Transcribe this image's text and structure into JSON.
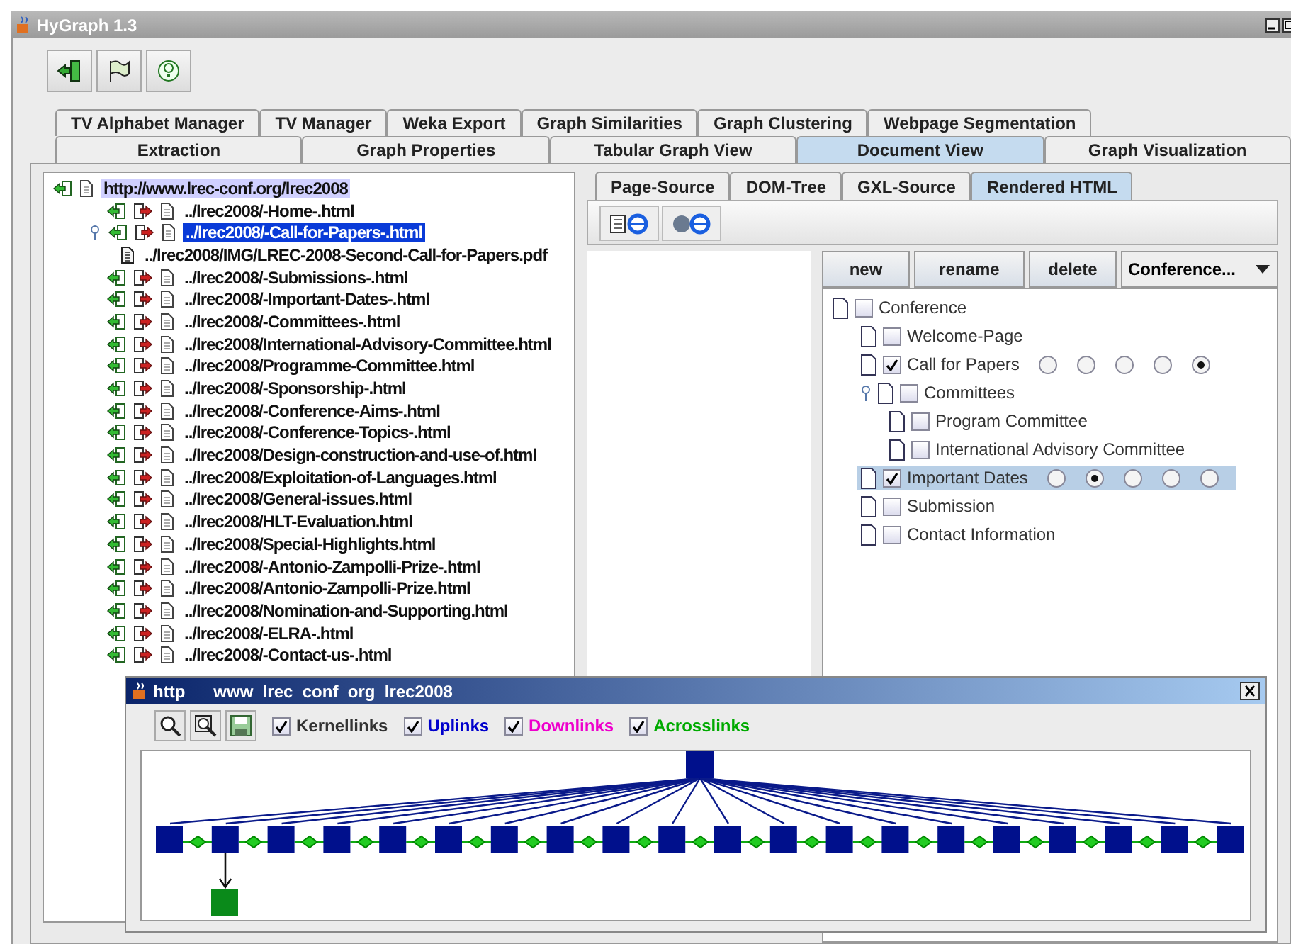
{
  "window": {
    "title": "HyGraph 1.3"
  },
  "tabs_row_1": [
    {
      "label": "TV Alphabet Manager",
      "selected": false
    },
    {
      "label": "TV Manager",
      "selected": false
    },
    {
      "label": "Weka Export",
      "selected": false
    },
    {
      "label": "Graph Similarities",
      "selected": false
    },
    {
      "label": "Graph Clustering",
      "selected": false
    },
    {
      "label": "Webpage Segmentation",
      "selected": false
    }
  ],
  "tabs_row_2": [
    {
      "label": "Extraction",
      "selected": false
    },
    {
      "label": "Graph Properties",
      "selected": false
    },
    {
      "label": "Tabular Graph View",
      "selected": false
    },
    {
      "label": "Document View",
      "selected": true
    },
    {
      "label": "Graph Visualization",
      "selected": false
    }
  ],
  "site_tree": {
    "label": "http://www.lrec-conf.org/lrec2008",
    "kind": "root",
    "highlighted": true,
    "children": [
      {
        "label": "../lrec2008/-Home-.html",
        "kind": "page",
        "selected": false
      },
      {
        "label": "../lrec2008/-Call-for-Papers-.html",
        "kind": "page",
        "selected": true,
        "expanded": true,
        "children": [
          {
            "label": "../lrec2008/IMG/LREC-2008-Second-Call-for-Papers.pdf",
            "kind": "document",
            "selected": false
          }
        ]
      },
      {
        "label": "../lrec2008/-Submissions-.html",
        "kind": "page",
        "selected": false
      },
      {
        "label": "../lrec2008/-Important-Dates-.html",
        "kind": "page",
        "selected": false
      },
      {
        "label": "../lrec2008/-Committees-.html",
        "kind": "page",
        "selected": false
      },
      {
        "label": "../lrec2008/International-Advisory-Committee.html",
        "kind": "page",
        "selected": false
      },
      {
        "label": "../lrec2008/Programme-Committee.html",
        "kind": "page",
        "selected": false
      },
      {
        "label": "../lrec2008/-Sponsorship-.html",
        "kind": "page",
        "selected": false
      },
      {
        "label": "../lrec2008/-Conference-Aims-.html",
        "kind": "page",
        "selected": false
      },
      {
        "label": "../lrec2008/-Conference-Topics-.html",
        "kind": "page",
        "selected": false
      },
      {
        "label": "../lrec2008/Design-construction-and-use-of.html",
        "kind": "page",
        "selected": false
      },
      {
        "label": "../lrec2008/Exploitation-of-Languages.html",
        "kind": "page",
        "selected": false
      },
      {
        "label": "../lrec2008/General-issues.html",
        "kind": "page",
        "selected": false
      },
      {
        "label": "../lrec2008/HLT-Evaluation.html",
        "kind": "page",
        "selected": false
      },
      {
        "label": "../lrec2008/Special-Highlights.html",
        "kind": "page",
        "selected": false
      },
      {
        "label": "../lrec2008/-Antonio-Zampolli-Prize-.html",
        "kind": "page",
        "selected": false
      },
      {
        "label": "../lrec2008/Antonio-Zampolli-Prize.html",
        "kind": "page",
        "selected": false
      },
      {
        "label": "../lrec2008/Nomination-and-Supporting.html",
        "kind": "page",
        "selected": false
      },
      {
        "label": "../lrec2008/-ELRA-.html",
        "kind": "page",
        "selected": false
      },
      {
        "label": "../lrec2008/-Contact-us-.html",
        "kind": "page",
        "selected": false
      }
    ]
  },
  "document_tabs": [
    {
      "label": "Page-Source",
      "selected": false
    },
    {
      "label": "DOM-Tree",
      "selected": false
    },
    {
      "label": "GXL-Source",
      "selected": false
    },
    {
      "label": "Rendered HTML",
      "selected": true
    }
  ],
  "segment_buttons": [
    "new",
    "rename",
    "delete"
  ],
  "segment_combo": {
    "value": "Conference..."
  },
  "segment_tree": {
    "label": "Conference",
    "checked": false,
    "selected": false,
    "children": [
      {
        "label": "Welcome-Page",
        "checked": false,
        "selected": false
      },
      {
        "label": "Call for Papers",
        "checked": true,
        "selected": false,
        "ratings": [
          {
            "selected": false
          },
          {
            "selected": false
          },
          {
            "selected": false
          },
          {
            "selected": false
          },
          {
            "selected": true
          }
        ]
      },
      {
        "label": "Committees",
        "checked": false,
        "selected": false,
        "expanded": true,
        "children": [
          {
            "label": "Program Committee",
            "checked": false,
            "selected": false
          },
          {
            "label": "International Advisory Committee",
            "checked": false,
            "selected": false
          }
        ]
      },
      {
        "label": "Important Dates",
        "checked": true,
        "selected": true,
        "ratings": [
          {
            "selected": false
          },
          {
            "selected": true
          },
          {
            "selected": false
          },
          {
            "selected": false
          },
          {
            "selected": false
          }
        ]
      },
      {
        "label": "Submission",
        "checked": false,
        "selected": false
      },
      {
        "label": "Contact Information",
        "checked": false,
        "selected": false
      }
    ]
  },
  "graph_window": {
    "title": "http___www_lrec_conf_org_lrec2008_",
    "filters": [
      {
        "label": "Kernellinks",
        "checked": true,
        "color": "#333333"
      },
      {
        "label": "Uplinks",
        "checked": true,
        "color": "#0000cc"
      },
      {
        "label": "Downlinks",
        "checked": true,
        "color": "#ee00cc"
      },
      {
        "label": "Acrosslinks",
        "checked": true,
        "color": "#00aa00"
      }
    ]
  }
}
